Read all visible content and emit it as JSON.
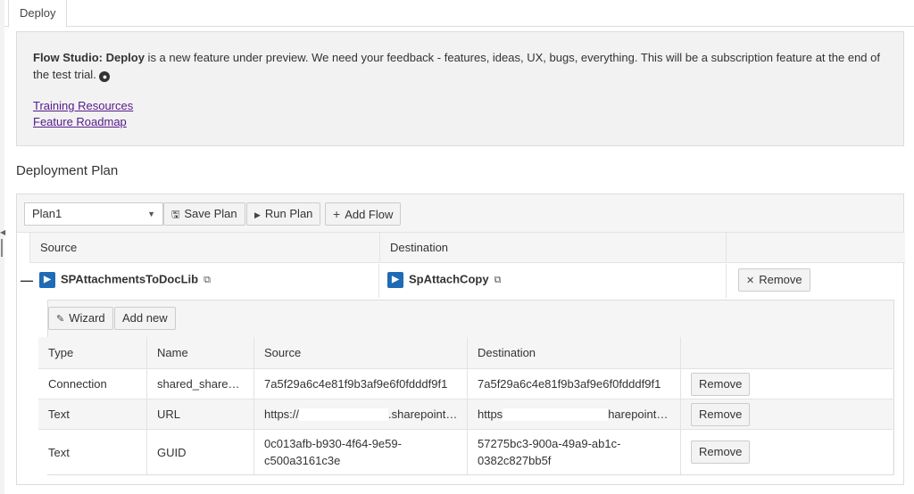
{
  "tab": {
    "label": "Deploy"
  },
  "info": {
    "title_bold": "Flow Studio: Deploy",
    "text": " is a new feature under preview. We need your feedback - features, ideas, UX, bugs, everything. This will be a subscription feature at the end of the test trial.",
    "link_training": "Training Resources",
    "link_roadmap": "Feature Roadmap"
  },
  "section_title": "Deployment Plan",
  "toolbar": {
    "plan_select_value": "Plan1",
    "save_label": "Save Plan",
    "run_label": "Run Plan",
    "add_flow_label": "Add Flow"
  },
  "plan_table": {
    "headers": {
      "source": "Source",
      "destination": "Destination"
    },
    "row": {
      "source_flow": "SPAttachmentsToDocLib",
      "destination_flow": "SpAttachCopy",
      "remove_label": "Remove"
    }
  },
  "sub": {
    "wizard_label": "Wizard",
    "add_new_label": "Add new",
    "headers": {
      "type": "Type",
      "name": "Name",
      "source": "Source",
      "destination": "Destination"
    },
    "rows": [
      {
        "type": "Connection",
        "name": "shared_share…",
        "source": "7a5f29a6c4e81f9b3af9e6f0fdddf9f1",
        "destination": "7a5f29a6c4e81f9b3af9e6f0fdddf9f1",
        "remove": "Remove"
      },
      {
        "type": "Text",
        "name": "URL",
        "source_prefix": "https://",
        "source_suffix": ".sharepoint…",
        "destination_prefix": "https",
        "destination_suffix": "harepoint…",
        "remove": "Remove"
      },
      {
        "type": "Text",
        "name": "GUID",
        "source_l1": "0c013afb-b930-4f64-9e59-",
        "source_l2": "c500a3161c3e",
        "destination_l1": "57275bc3-900a-49a9-ab1c-",
        "destination_l2": "0382c827bb5f",
        "remove": "Remove"
      }
    ]
  }
}
